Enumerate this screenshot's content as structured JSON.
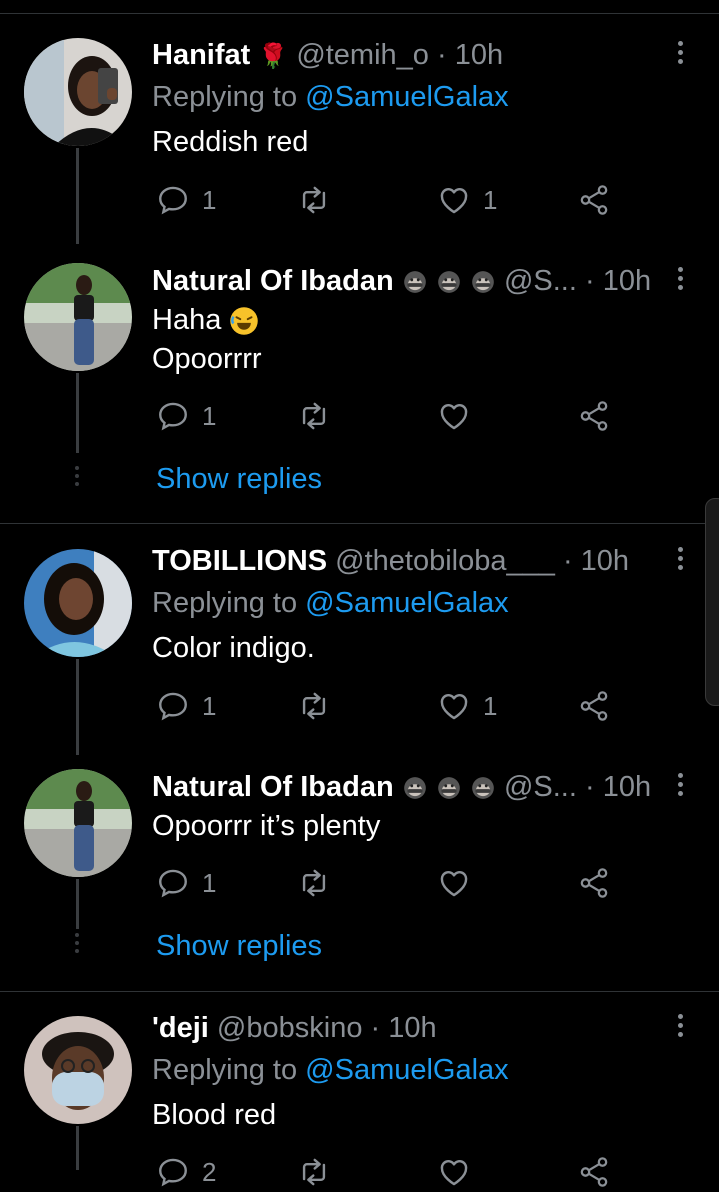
{
  "tweets": [
    {
      "name": "Hanifat",
      "name_emoji": "🌹",
      "handle": "@temih_o",
      "time": "10h",
      "replying_prefix": "Replying to ",
      "replying_mention": "@SamuelGalax",
      "text": "Reddish red",
      "reply_count": "1",
      "like_count": "1"
    },
    {
      "name": "Natural Of Ibadan",
      "handle": "@S...",
      "time": "10h",
      "text_lines": [
        "Haha",
        "Opoorrrr"
      ],
      "reply_count": "1",
      "like_count": "",
      "show_replies": "Show replies"
    },
    {
      "name": "TOBILLIONS",
      "handle": "@thetobiloba___",
      "time": "10h",
      "replying_prefix": "Replying to ",
      "replying_mention": "@SamuelGalax",
      "text": "Color indigo.",
      "reply_count": "1",
      "like_count": "1"
    },
    {
      "name": "Natural Of Ibadan",
      "handle": "@S...",
      "time": "10h",
      "text": "Opoorrr it’s plenty",
      "reply_count": "1",
      "like_count": "",
      "show_replies": "Show replies"
    },
    {
      "name": "'deji",
      "handle": "@bobskino",
      "time": "10h",
      "replying_prefix": "Replying to ",
      "replying_mention": "@SamuelGalax",
      "text": "Blood red",
      "reply_count": "2"
    }
  ],
  "separator": "·",
  "colors": {
    "background": "#000000",
    "accent": "#1d9bf0",
    "secondary": "#8b9096",
    "divider": "#2f3336"
  },
  "icons": [
    "reply-icon",
    "retweet-icon",
    "like-icon",
    "share-icon",
    "more-icon",
    "monkey-icon",
    "rose-icon",
    "laughing-emoji"
  ]
}
